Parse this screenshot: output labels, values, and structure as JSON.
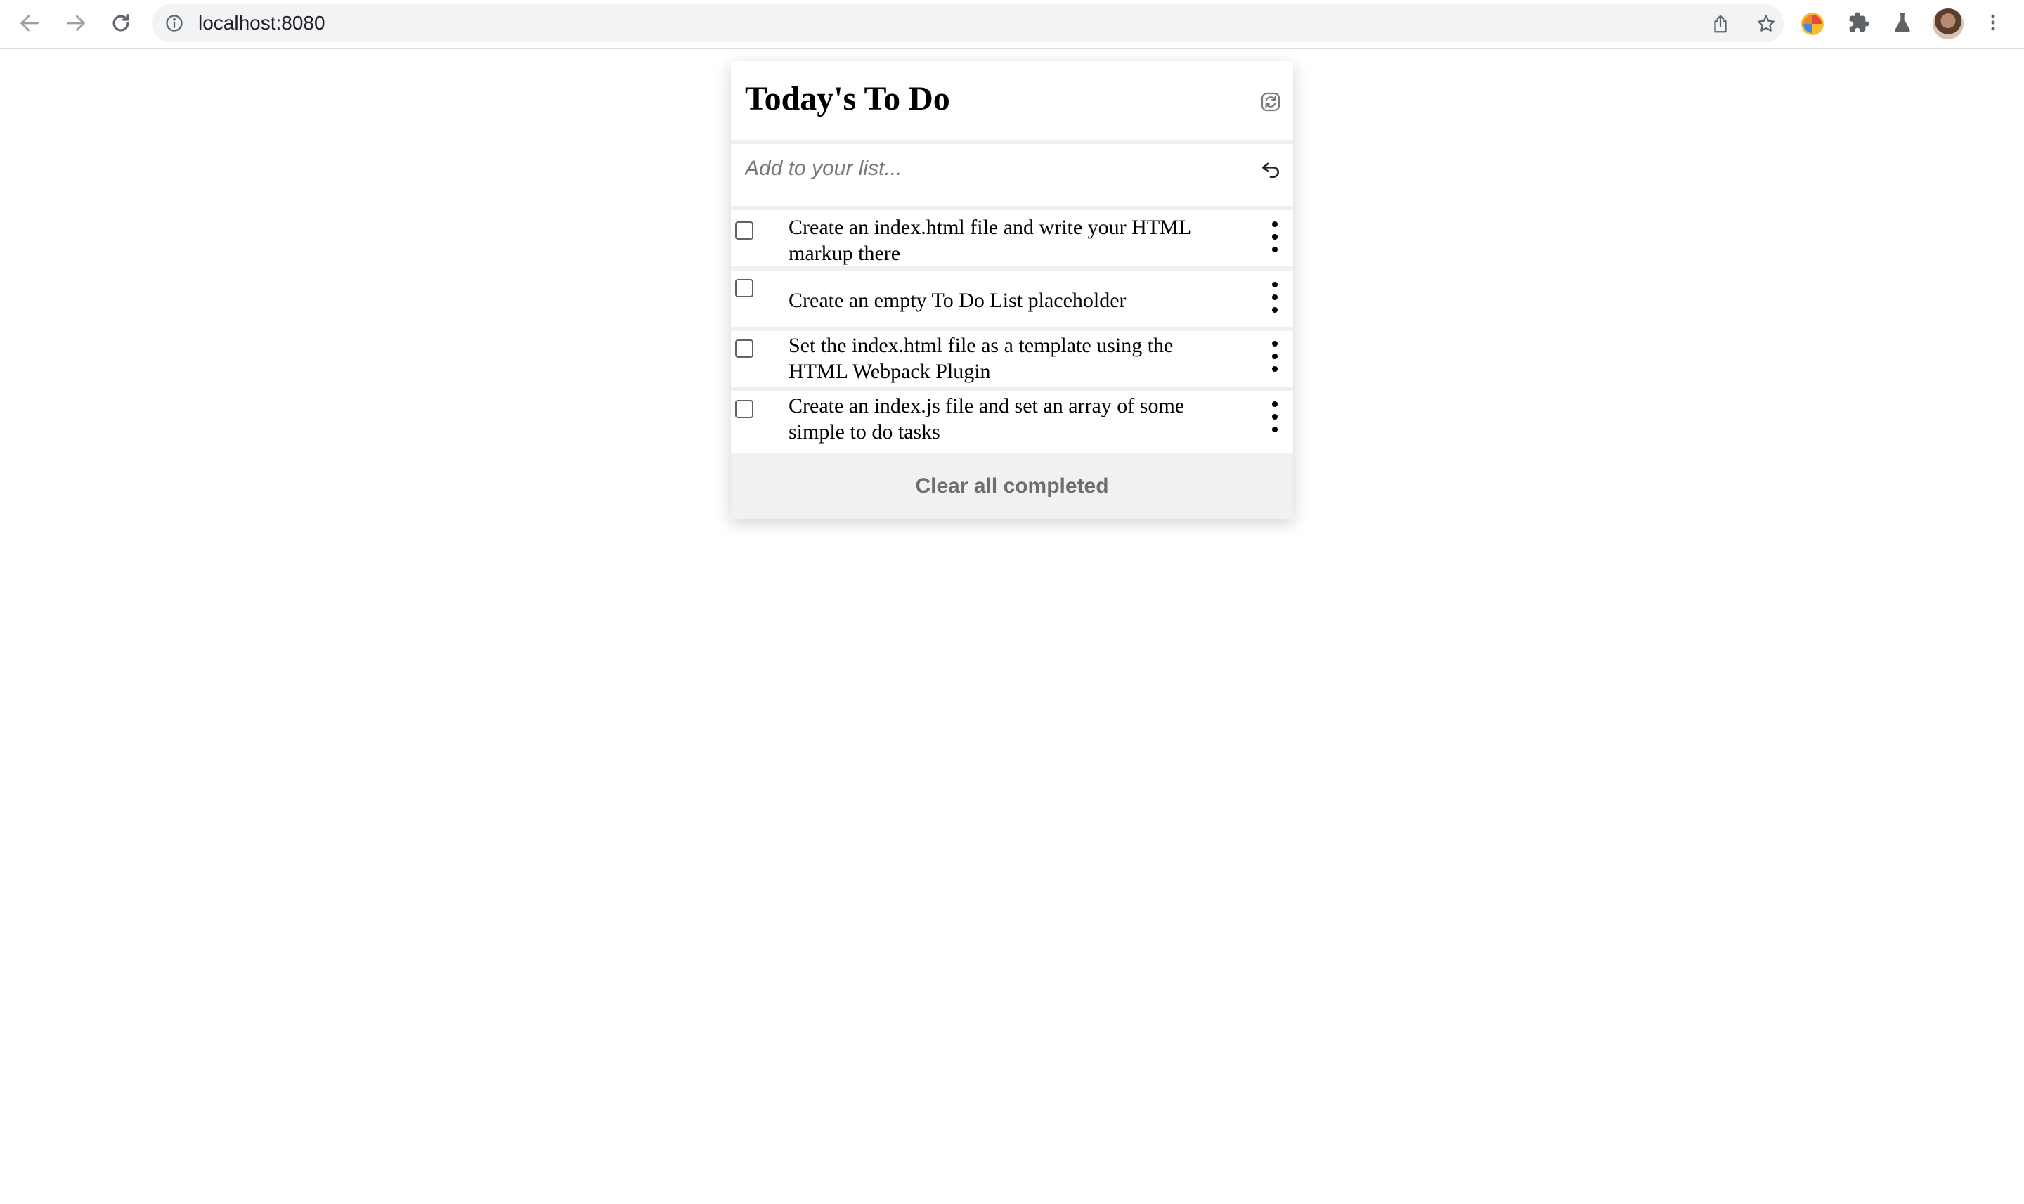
{
  "browser": {
    "url": "localhost:8080"
  },
  "app": {
    "title": "Today's To Do",
    "input_placeholder": "Add to your list...",
    "todos": [
      {
        "text": "Create an index.html file and write your HTML markup there",
        "completed": false
      },
      {
        "text": "Create an empty To Do List placeholder",
        "completed": false
      },
      {
        "text": "Set the index.html file as a template using the HTML Webpack Plugin",
        "completed": false
      },
      {
        "text": "Create an index.js file and set an array of some simple to do tasks",
        "completed": false
      }
    ],
    "clear_label": "Clear all completed"
  },
  "icons": {
    "back": "arrow-left-icon",
    "forward": "arrow-right-icon",
    "reload": "reload-icon",
    "info": "info-icon",
    "share": "share-icon",
    "bookmark": "star-icon",
    "extension": "puzzle-icon",
    "labs": "flask-icon",
    "menu": "kebab-icon",
    "refresh": "refresh-icon",
    "enter": "enter-icon",
    "item_menu": "more-vertical-icon"
  },
  "colors": {
    "card_divider": "#f0f0f0",
    "clear_bg": "#f1f1f1",
    "clear_text": "#6e6e6e",
    "placeholder_text": "#777777"
  }
}
